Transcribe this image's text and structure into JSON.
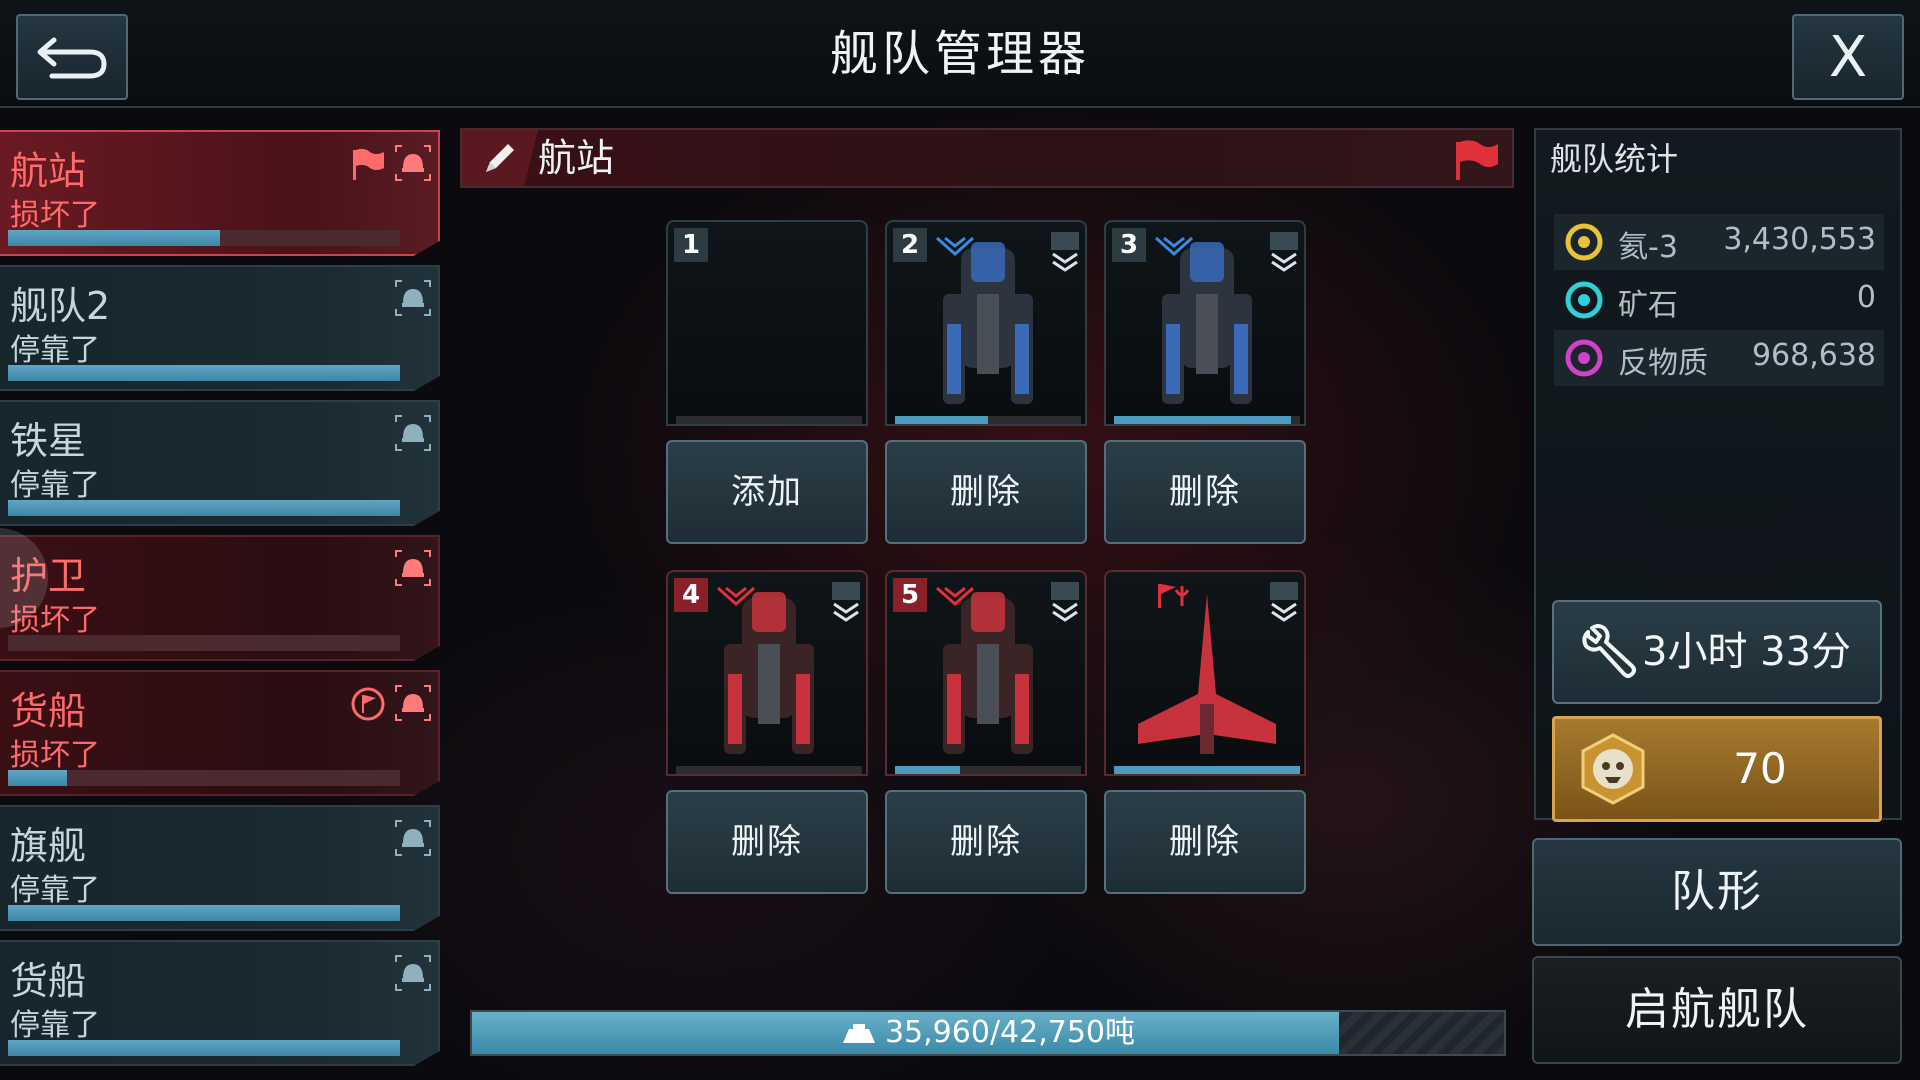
{
  "header": {
    "title": "舰队管理器",
    "back_icon": "back-arrow-icon",
    "close_label": "X"
  },
  "fleets": [
    {
      "name": "航站",
      "status": "损坏了",
      "health": 0.54,
      "state": "selected",
      "flag": "flag"
    },
    {
      "name": "舰队2",
      "status": "停靠了",
      "health": 1.0,
      "state": "ok",
      "flag": ""
    },
    {
      "name": "铁星",
      "status": "停靠了",
      "health": 1.0,
      "state": "ok",
      "flag": ""
    },
    {
      "name": "护卫",
      "status": "损坏了",
      "health": 0.0,
      "state": "bad",
      "flag": ""
    },
    {
      "name": "货船",
      "status": "损坏了",
      "health": 0.15,
      "state": "bad",
      "flag": "circle-flag"
    },
    {
      "name": "旗舰",
      "status": "停靠了",
      "health": 1.0,
      "state": "ok",
      "flag": ""
    },
    {
      "name": "货船",
      "status": "停靠了",
      "health": 1.0,
      "state": "ok",
      "flag": ""
    }
  ],
  "fleet_detail": {
    "name": "航站",
    "slots": [
      {
        "num": "1",
        "empty": true,
        "health": 0,
        "action": "添加",
        "color": "blue"
      },
      {
        "num": "2",
        "empty": false,
        "health": 0.5,
        "action": "删除",
        "color": "blue"
      },
      {
        "num": "3",
        "empty": false,
        "health": 0.95,
        "action": "删除",
        "color": "blue"
      },
      {
        "num": "4",
        "empty": false,
        "health": 0.0,
        "action": "删除",
        "color": "red"
      },
      {
        "num": "5",
        "empty": false,
        "health": 0.35,
        "action": "删除",
        "color": "red"
      },
      {
        "num": "",
        "empty": false,
        "health": 1.0,
        "action": "删除",
        "color": "red",
        "flagship": true
      }
    ],
    "tonnage": "35,960/42,750吨",
    "tonnage_fraction": 0.84
  },
  "stats": {
    "title": "舰队统计",
    "resources": [
      {
        "icon": "helium-icon",
        "name": "氦-3",
        "value": "3,430,553",
        "color": "#e8c23a"
      },
      {
        "icon": "ore-icon",
        "name": "矿石",
        "value": "0",
        "color": "#2fd0d8"
      },
      {
        "icon": "antimatter-icon",
        "name": "反物质",
        "value": "968,638",
        "color": "#d040c8"
      }
    ],
    "repair_time": "3小时 33分",
    "gold_value": "70"
  },
  "buttons": {
    "formation": "队形",
    "launch": "启航舰队"
  }
}
